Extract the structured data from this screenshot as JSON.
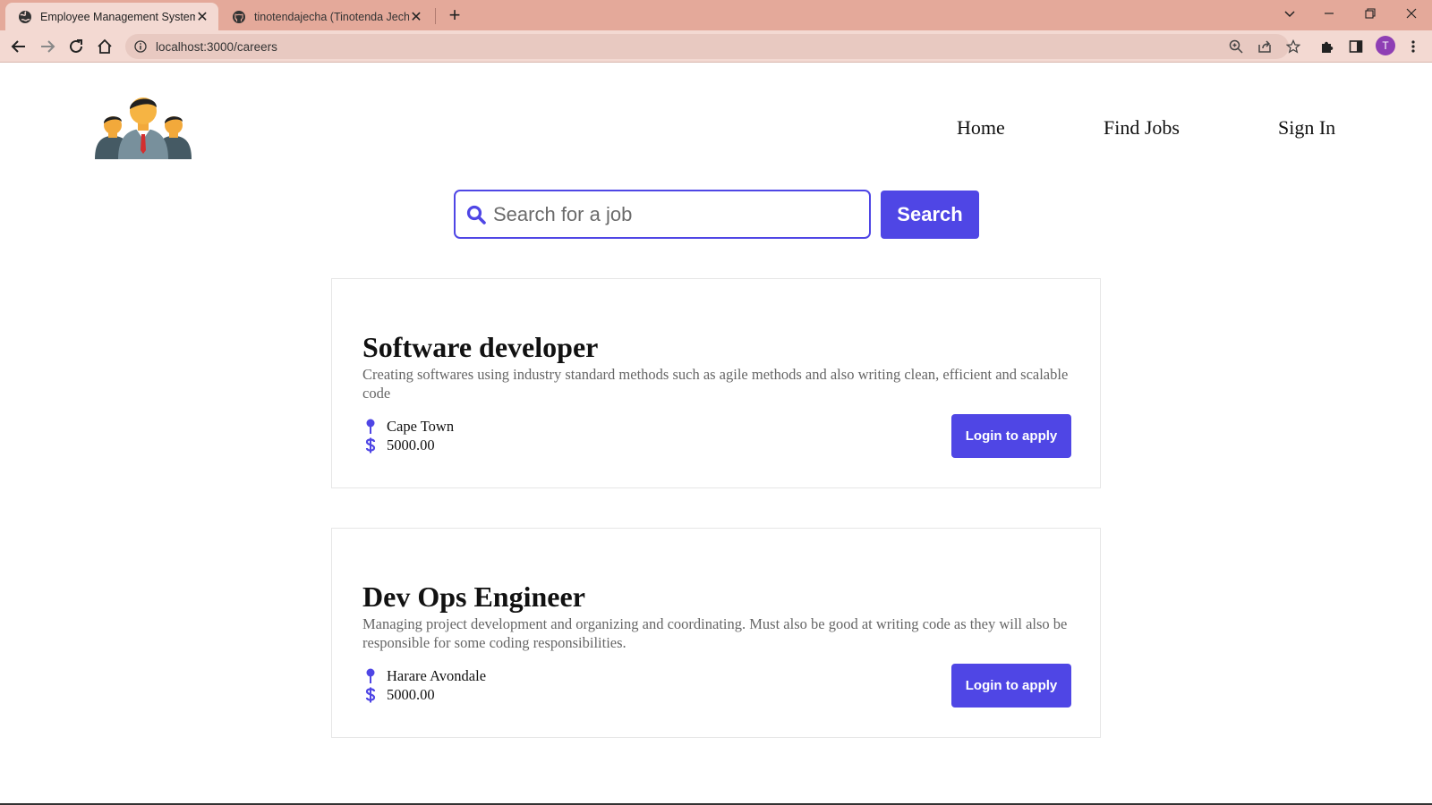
{
  "browser": {
    "tabs": [
      {
        "title": "Employee Management System",
        "active": true,
        "icon": "globe-icon"
      },
      {
        "title": "tinotendajecha (Tinotenda Jecha)",
        "active": false,
        "icon": "github-icon"
      }
    ],
    "url": "localhost:3000/careers",
    "profile_initial": "T",
    "tab_color": "#e4a99a",
    "toolbar_color": "#f3d9d2"
  },
  "header": {
    "logo": "team-people-icon",
    "nav": {
      "home": "Home",
      "find_jobs": "Find Jobs",
      "sign_in": "Sign In"
    }
  },
  "search": {
    "placeholder": "Search for a job",
    "value": "",
    "button_label": "Search"
  },
  "jobs": [
    {
      "title": "Software developer",
      "description": "Creating softwares using industry standard methods such as agile methods and also writing clean, efficient and scalable code",
      "location": "Cape Town",
      "salary": "5000.00",
      "apply_label": "Login to apply"
    },
    {
      "title": "Dev Ops Engineer",
      "description": "Managing project development and organizing and coordinating. Must also be good at writing code as they will also be responsible for some coding responsibilities.",
      "location": "Harare Avondale",
      "salary": "5000.00",
      "apply_label": "Login to apply"
    }
  ],
  "colors": {
    "accent": "#4f46e5"
  }
}
